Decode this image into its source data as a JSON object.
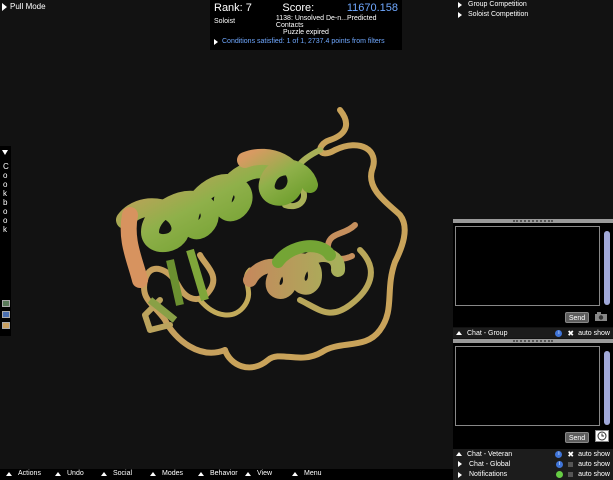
{
  "pull_mode": "Pull Mode",
  "score_panel": {
    "rank_label": "Rank: 7",
    "score_label": "Score:",
    "score_value": "11670.158",
    "mode": "Soloist",
    "puzzle": "1138: Unsolved De-n...Predicted Contacts",
    "status": "Puzzle expired",
    "conditions": "Conditions satisfied: 1 of 1, 2737.4 points from filters"
  },
  "competitions": [
    "Group Competition",
    "Soloist Competition"
  ],
  "cookbook": {
    "letters": [
      "C",
      "o",
      "o",
      "k",
      "b",
      "o",
      "o",
      "k"
    ]
  },
  "chat_group": {
    "send_label": "Send",
    "bar_label": "Chat - Group",
    "auto_label": "auto show"
  },
  "chat_veteran": {
    "send_label": "Send",
    "bar_label": "Chat - Veteran",
    "auto_label": "auto show"
  },
  "chat_global": {
    "bar_label": "Chat - Global",
    "auto_label": "auto show"
  },
  "notifications": {
    "bar_label": "Notifications",
    "auto_label": "auto show"
  },
  "bottom_menu": [
    "Actions",
    "Undo",
    "Social",
    "Modes",
    "Behavior",
    "View",
    "Menu"
  ],
  "colors": {
    "accent_blue": "#6fa8ff",
    "ribbon_green": "#7fa33a",
    "ribbon_orange": "#c98a55",
    "background": "#121212"
  }
}
